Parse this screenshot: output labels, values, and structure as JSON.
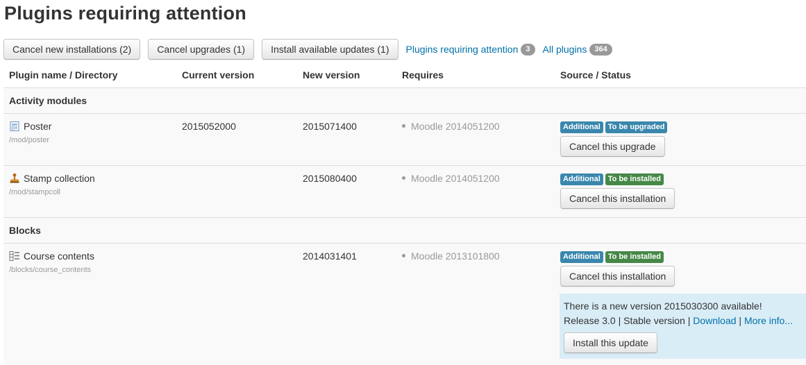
{
  "page": {
    "title": "Plugins requiring attention"
  },
  "toolbar": {
    "cancel_new_label": "Cancel new installations (2)",
    "cancel_upgrades_label": "Cancel upgrades (1)",
    "install_updates_label": "Install available updates (1)",
    "filter_attention_label": "Plugins requiring attention",
    "filter_attention_count": "3",
    "filter_all_label": "All plugins",
    "filter_all_count": "364"
  },
  "table": {
    "columns": [
      "Plugin name / Directory",
      "Current version",
      "New version",
      "Requires",
      "Source / Status"
    ],
    "groups": [
      {
        "name": "Activity modules",
        "plugins": [
          {
            "icon": "poster-icon",
            "name": "Poster",
            "dir": "/mod/poster",
            "current": "2015052000",
            "new": "2015071400",
            "requires": "Moodle 2014051200",
            "source": "Additional",
            "status": "To be upgraded",
            "action": "Cancel this upgrade"
          },
          {
            "icon": "stamp-icon",
            "name": "Stamp collection",
            "dir": "/mod/stampcoll",
            "current": "",
            "new": "2015080400",
            "requires": "Moodle 2014051200",
            "source": "Additional",
            "status": "To be installed",
            "action": "Cancel this installation"
          }
        ]
      },
      {
        "name": "Blocks",
        "plugins": [
          {
            "icon": "block-icon",
            "name": "Course contents",
            "dir": "/blocks/course_contents",
            "current": "",
            "new": "2014031401",
            "requires": "Moodle 2013101800",
            "source": "Additional",
            "status": "To be installed",
            "action": "Cancel this installation",
            "update": {
              "message": "There is a new version 2015030300 available!",
              "release": "Release 3.0 | Stable version | ",
              "download_label": "Download",
              "separator": " | ",
              "more_info_label": "More info...",
              "install_label": "Install this update"
            }
          }
        ]
      }
    ]
  },
  "colors": {
    "link": "#0070a8",
    "label_info": "#3a87ad",
    "label_success": "#468847",
    "update_box": "#d9edf7"
  }
}
